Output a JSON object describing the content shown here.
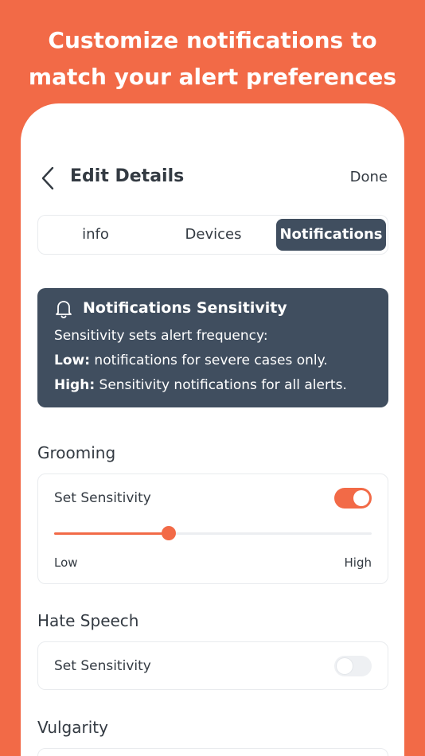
{
  "headline": [
    "Customize notifications to",
    "match your alert preferences"
  ],
  "header": {
    "title": "Edit Details",
    "done_label": "Done"
  },
  "tabs": [
    {
      "label": "info",
      "active": false
    },
    {
      "label": "Devices",
      "active": false
    },
    {
      "label": "Notifications",
      "active": true
    }
  ],
  "info_card": {
    "title": "Notifications Sensitivity",
    "line1": "Sensitivity sets alert frequency:",
    "low_label": "Low:",
    "low_text": " notifications for severe cases only.",
    "high_label": "High:",
    "high_text": " Sensitivity notifications for all alerts."
  },
  "sections": [
    {
      "label": "Grooming",
      "set_label": "Set Sensitivity",
      "enabled": true,
      "level": 0.36,
      "low": "Low",
      "high": "High"
    },
    {
      "label": "Hate Speech",
      "set_label": "Set Sensitivity",
      "enabled": false
    },
    {
      "label": "Vulgarity"
    }
  ],
  "colors": {
    "brand": "#F26A47",
    "dark": "#404E5F",
    "text": "#333A42"
  }
}
